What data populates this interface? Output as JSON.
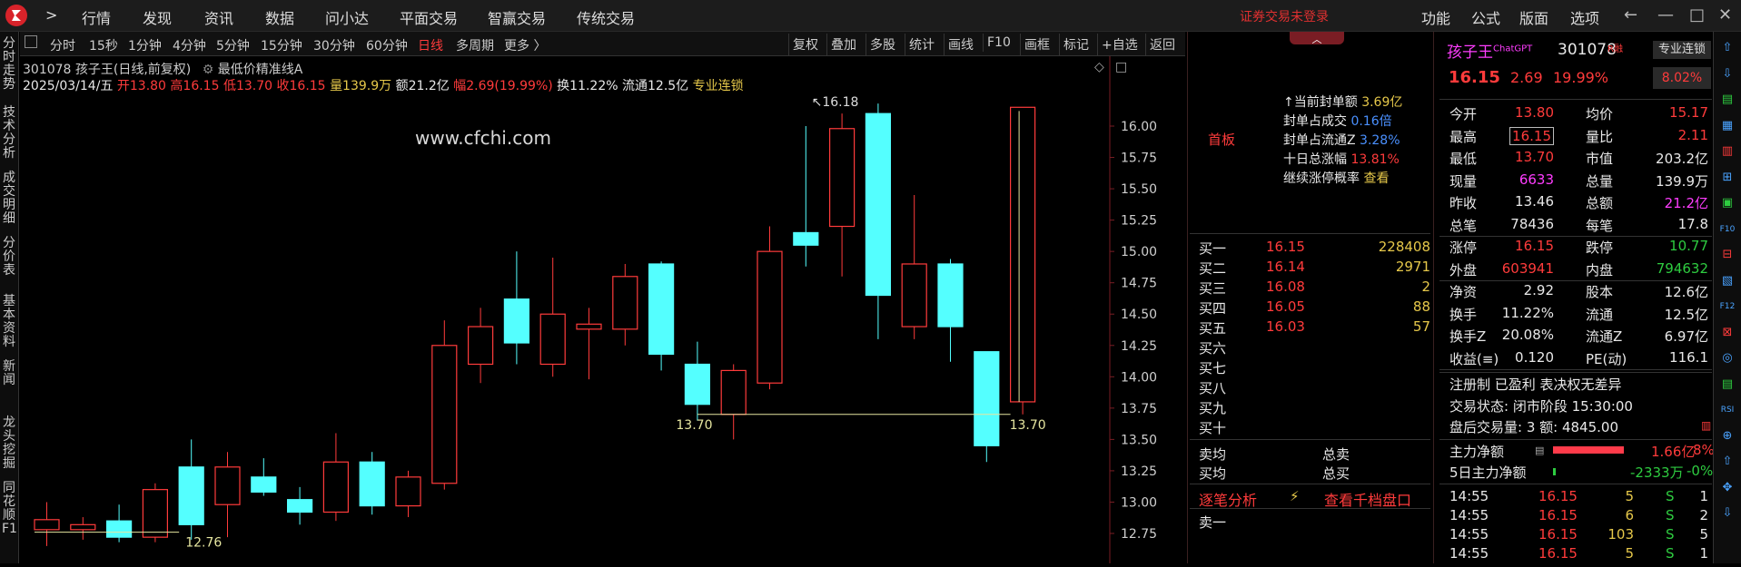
{
  "topbar": {
    "nav_back": ">",
    "menus": [
      "行情",
      "发现",
      "资讯",
      "数据",
      "问小达",
      "平面交易",
      "智赢交易",
      "传统交易"
    ],
    "notice": "证券交易未登录",
    "right_menus": [
      "功能",
      "公式",
      "版面",
      "选项"
    ],
    "window_buttons": [
      "←",
      "—",
      "□",
      "✕"
    ]
  },
  "left_tabs": [
    "分时走势",
    "技术分析",
    "成交明细",
    "分价表",
    "基本资料",
    "新闻",
    "龙头挖掘",
    "同花顺F1"
  ],
  "toolbar": {
    "periods": [
      "分时",
      "15秒",
      "1分钟",
      "4分钟",
      "5分钟",
      "15分钟",
      "30分钟",
      "60分钟",
      "日线",
      "多周期",
      "更多 〉"
    ],
    "active_period": "日线",
    "buttons": [
      "复权",
      "叠加",
      "多股",
      "统计",
      "画线",
      "F10",
      "画框",
      "标记",
      "+自选",
      "返回"
    ]
  },
  "chart_header": {
    "line1": "301078 孩子王(日线,前复权)",
    "line1_extra": "最低价精准线A",
    "date": "2025/03/14/五",
    "open_label": "开13.80",
    "high_label": "高16.15",
    "low_label": "低13.70",
    "close_label": "收16.15",
    "vol_label": "量139.9万",
    "amount_label": "额21.2亿",
    "range_label": "幅2.69(19.99%)",
    "turnover_label": "换11.22%",
    "float_label": "流通12.5亿",
    "tag": "专业连锁",
    "watermark": "www.cfchi.com"
  },
  "chart_data": {
    "type": "candlestick",
    "y_ticks": [
      12.75,
      13.0,
      13.25,
      13.5,
      13.75,
      14.0,
      14.25,
      14.5,
      14.75,
      15.0,
      15.25,
      15.5,
      15.75,
      16.0
    ],
    "candles": [
      {
        "o": 12.78,
        "h": 13.0,
        "l": 12.65,
        "c": 12.86
      },
      {
        "o": 12.78,
        "h": 12.88,
        "l": 12.7,
        "c": 12.82
      },
      {
        "o": 12.85,
        "h": 12.98,
        "l": 12.68,
        "c": 12.72
      },
      {
        "o": 12.72,
        "h": 13.15,
        "l": 12.68,
        "c": 13.1
      },
      {
        "o": 13.28,
        "h": 13.5,
        "l": 12.7,
        "c": 12.82
      },
      {
        "o": 12.98,
        "h": 13.4,
        "l": 12.72,
        "c": 13.28
      },
      {
        "o": 13.2,
        "h": 13.35,
        "l": 13.05,
        "c": 13.08
      },
      {
        "o": 13.02,
        "h": 13.12,
        "l": 12.82,
        "c": 12.92
      },
      {
        "o": 12.92,
        "h": 13.55,
        "l": 12.85,
        "c": 13.32
      },
      {
        "o": 13.32,
        "h": 13.4,
        "l": 12.9,
        "c": 12.97
      },
      {
        "o": 12.97,
        "h": 13.25,
        "l": 12.88,
        "c": 13.2
      },
      {
        "o": 13.15,
        "h": 14.45,
        "l": 13.1,
        "c": 14.25
      },
      {
        "o": 14.1,
        "h": 14.55,
        "l": 13.95,
        "c": 14.4
      },
      {
        "o": 14.62,
        "h": 15.0,
        "l": 14.1,
        "c": 14.27
      },
      {
        "o": 14.1,
        "h": 14.95,
        "l": 14.0,
        "c": 14.5
      },
      {
        "o": 14.38,
        "h": 14.55,
        "l": 13.98,
        "c": 14.42
      },
      {
        "o": 14.38,
        "h": 14.9,
        "l": 14.25,
        "c": 14.8
      },
      {
        "o": 14.9,
        "h": 14.92,
        "l": 14.05,
        "c": 14.18
      },
      {
        "o": 14.1,
        "h": 14.28,
        "l": 13.65,
        "c": 13.78
      },
      {
        "o": 13.7,
        "h": 14.1,
        "l": 13.5,
        "c": 14.05
      },
      {
        "o": 13.95,
        "h": 15.2,
        "l": 13.9,
        "c": 15.0
      },
      {
        "o": 15.15,
        "h": 16.0,
        "l": 14.88,
        "c": 15.05
      },
      {
        "o": 15.2,
        "h": 16.1,
        "l": 14.8,
        "c": 15.98
      },
      {
        "o": 16.1,
        "h": 16.18,
        "l": 14.3,
        "c": 14.65
      },
      {
        "o": 14.4,
        "h": 15.45,
        "l": 14.3,
        "c": 14.9
      },
      {
        "o": 14.9,
        "h": 14.94,
        "l": 14.12,
        "c": 14.4
      },
      {
        "o": 14.2,
        "h": 14.2,
        "l": 13.32,
        "c": 13.45
      },
      {
        "o": 13.8,
        "h": 16.15,
        "l": 13.7,
        "c": 16.15
      }
    ],
    "annotations": [
      "16.18",
      "13.70",
      "13.70",
      "12.76"
    ],
    "bull_color": "#ff3b3b",
    "bear_color": "#54ffff"
  },
  "mid_panel": {
    "first_board": "首板",
    "seal_stats": [
      {
        "label": "↑当前封单额",
        "value": "3.69亿"
      },
      {
        "label": "封单占成交",
        "value": "0.16倍"
      },
      {
        "label": "封单占流通Z",
        "value": "3.28%"
      },
      {
        "label": "十日总涨幅",
        "value": "13.81%"
      },
      {
        "label": "继续涨停概率",
        "value": "查看"
      }
    ],
    "bids": [
      {
        "label": "买一",
        "price": "16.15",
        "vol": "228408"
      },
      {
        "label": "买二",
        "price": "16.14",
        "vol": "2971"
      },
      {
        "label": "买三",
        "price": "16.08",
        "vol": "2"
      },
      {
        "label": "买四",
        "price": "16.05",
        "vol": "88"
      },
      {
        "label": "买五",
        "price": "16.03",
        "vol": "57"
      },
      {
        "label": "买六",
        "price": "",
        "vol": ""
      },
      {
        "label": "买七",
        "price": "",
        "vol": ""
      },
      {
        "label": "买八",
        "price": "",
        "vol": ""
      },
      {
        "label": "买九",
        "price": "",
        "vol": ""
      },
      {
        "label": "买十",
        "price": "",
        "vol": ""
      }
    ],
    "avg_sell_label": "卖均",
    "total_sell_label": "总卖",
    "avg_buy_label": "买均",
    "total_buy_label": "总买",
    "tick_tab": "逐笔分析",
    "lightning": "⚡",
    "thousand_link": "查看千档盘口",
    "sell_one": "卖一"
  },
  "quote": {
    "name": "孩子王",
    "chatgpt_tag": "ChatGPT",
    "code": "301078",
    "r_tag": "R",
    "rzrq_tag": "融",
    "sector_btn": "专业连锁",
    "sector_chg": "8.02%",
    "price": "16.15",
    "change": "2.69",
    "change_pct": "19.99%",
    "rows": [
      [
        "今开",
        "13.80",
        "均价",
        "15.17"
      ],
      [
        "最高",
        "16.15",
        "量比",
        "2.11"
      ],
      [
        "最低",
        "13.70",
        "市值",
        "203.2亿"
      ],
      [
        "现量",
        "6633",
        "总量",
        "139.9万"
      ],
      [
        "昨收",
        "13.46",
        "总额",
        "21.2亿"
      ],
      [
        "总笔",
        "78436",
        "每笔",
        "17.8"
      ],
      [
        "涨停",
        "16.15",
        "跌停",
        "10.77"
      ],
      [
        "外盘",
        "603941",
        "内盘",
        "794632"
      ],
      [
        "净资",
        "2.92",
        "股本",
        "12.6亿"
      ],
      [
        "换手",
        "11.22%",
        "流通",
        "12.5亿"
      ],
      [
        "换手Z",
        "20.08%",
        "流通Z",
        "6.97亿"
      ],
      [
        "收益(≡)",
        "0.120",
        "PE(动)",
        "116.1"
      ]
    ],
    "tags": "注册制  已盈利  表决权无差异",
    "trade_status": "交易状态: 闭市阶段 15:30:00",
    "after_hours": "盘后交易量: 3  额: 4845.00",
    "main_net_label": "主力净额",
    "main_net_value": "1.66亿",
    "main_net_pct": "8%",
    "main5_label": "5日主力净额",
    "main5_value": "-2333万",
    "main5_pct": "-0%",
    "ticks": [
      [
        "14:55",
        "16.15",
        "5",
        "S",
        "1"
      ],
      [
        "14:55",
        "16.15",
        "6",
        "S",
        "2"
      ],
      [
        "14:55",
        "16.15",
        "103",
        "S",
        "5"
      ],
      [
        "14:55",
        "16.15",
        "5",
        "S",
        "1"
      ]
    ]
  },
  "right_tools": [
    "⇧",
    "⇩",
    "▤",
    "▦",
    "▥",
    "⊞",
    "▣",
    "F10",
    "⊟",
    "▧",
    "F12",
    "⊠",
    "◎",
    "▤",
    "RSI",
    "⊕",
    "⇧",
    "✥",
    "⇩"
  ]
}
